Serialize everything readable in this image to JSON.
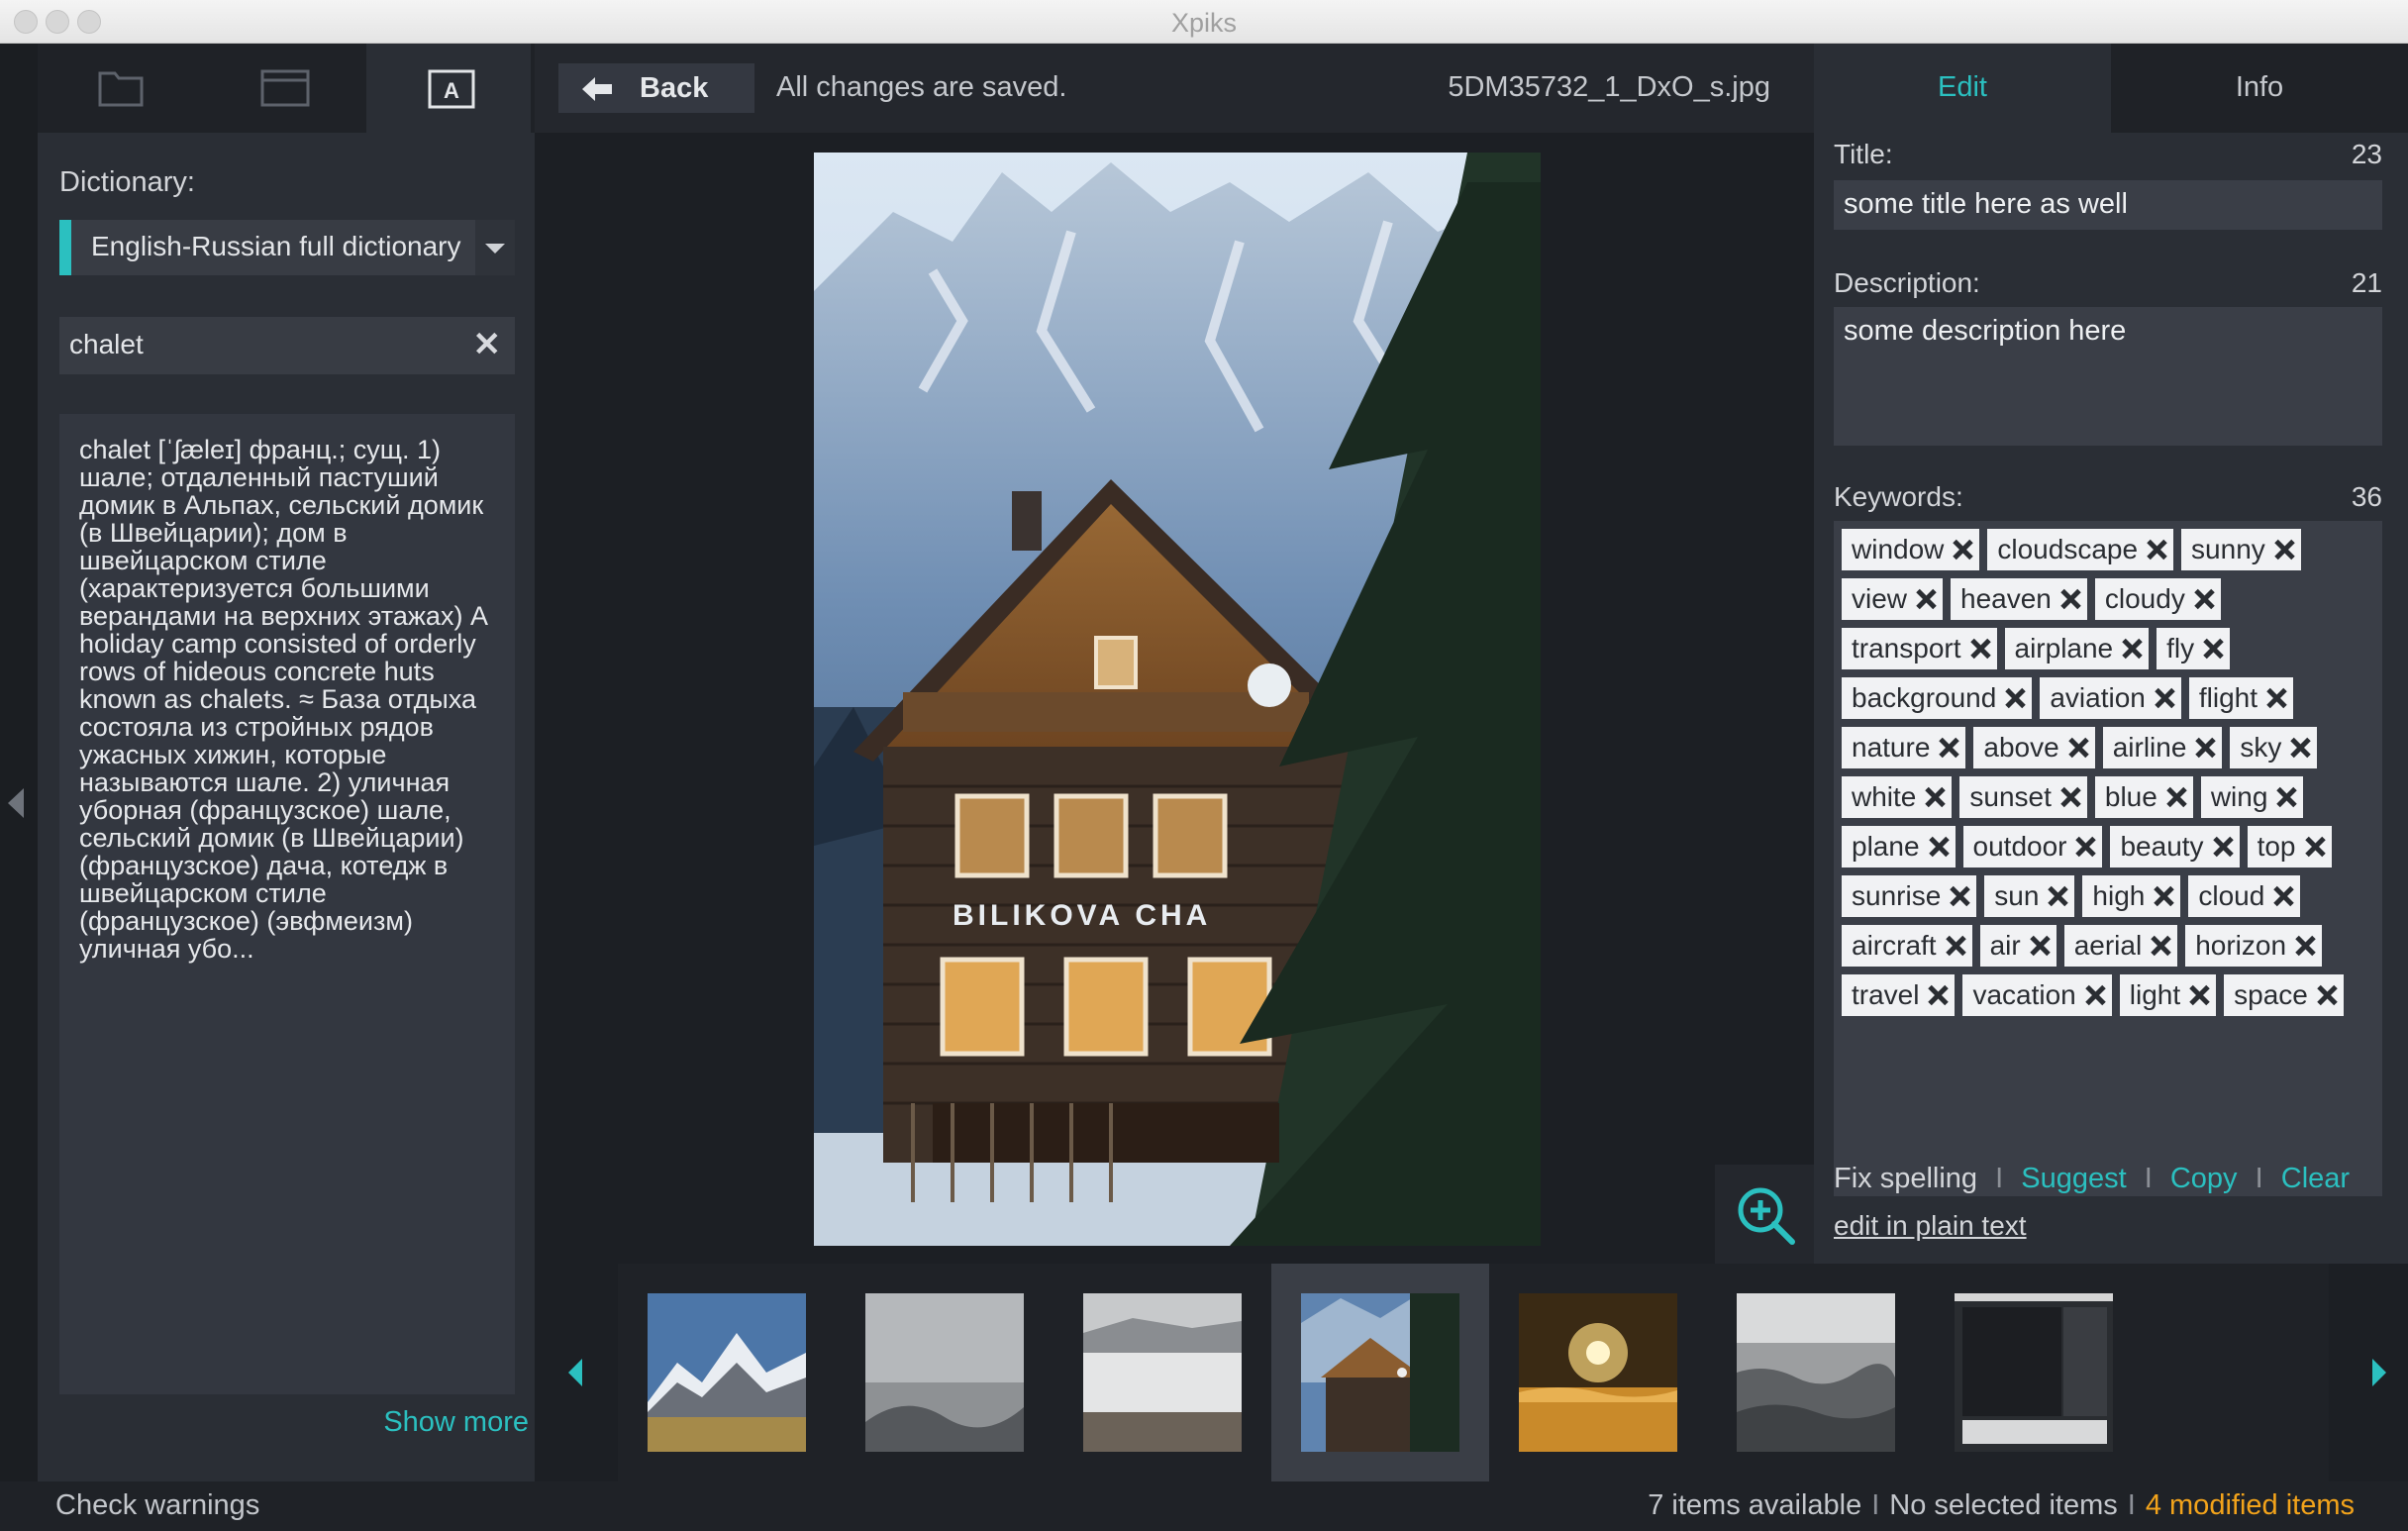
{
  "app": {
    "title": "Xpiks"
  },
  "left_panel": {
    "tabs": [
      {
        "icon": "folder-icon"
      },
      {
        "icon": "window-icon"
      },
      {
        "icon": "dictionary-icon",
        "letter": "A",
        "active": true
      }
    ],
    "dictionary_label": "Dictionary:",
    "dictionary_selected": "English-Russian full dictionary",
    "search_value": "chalet",
    "definition": "chalet [ˈʃæleɪ] франц.; сущ. 1) шале; отдаленный пастуший домик в Альпах, сельский домик (в Швейцарии); дом в швейцарском стиле (характеризуется большими верандами на верхних этажах) A holiday camp consisted of orderly rows of hideous concrete huts known as chalets. ≈ База отдыха состояла из стройных рядов ужасных хижин, которые называются шале. 2) уличная уборная (французское) шале, сельский домик (в Швейцарии) (французское) дача, котедж в швейцарском стиле (французское) (эвфмеизм) уличная убо...",
    "show_more": "Show more"
  },
  "center": {
    "back_label": "Back",
    "save_status": "All changes are saved.",
    "filename": "5DM35732_1_DxO_s.jpg",
    "photo_sign": "BILIKOVA CHA"
  },
  "filmstrip": {
    "thumbnails": [
      {
        "name": "mountains-thumb",
        "selected": false
      },
      {
        "name": "fog-forest-thumb",
        "selected": false
      },
      {
        "name": "misty-valley-thumb",
        "selected": false
      },
      {
        "name": "chalet-thumb",
        "selected": true
      },
      {
        "name": "sunset-clouds-thumb",
        "selected": false
      },
      {
        "name": "cloud-layer-thumb",
        "selected": false
      },
      {
        "name": "screenshot-thumb",
        "selected": false
      }
    ]
  },
  "right_panel": {
    "tabs": {
      "edit": "Edit",
      "info": "Info"
    },
    "title_label": "Title:",
    "title_count": "23",
    "title_value": "some title here as well",
    "description_label": "Description:",
    "description_count": "21",
    "description_value": "some description here",
    "keywords_label": "Keywords:",
    "keywords_count": "36",
    "keywords": [
      "window",
      "cloudscape",
      "sunny",
      "view",
      "heaven",
      "cloudy",
      "transport",
      "airplane",
      "fly",
      "background",
      "aviation",
      "flight",
      "nature",
      "above",
      "airline",
      "sky",
      "white",
      "sunset",
      "blue",
      "wing",
      "plane",
      "outdoor",
      "beauty",
      "top",
      "sunrise",
      "sun",
      "high",
      "cloud",
      "aircraft",
      "air",
      "aerial",
      "horizon",
      "travel",
      "vacation",
      "light",
      "space"
    ],
    "actions": {
      "fix_spelling": "Fix spelling",
      "suggest": "Suggest",
      "copy": "Copy",
      "clear": "Clear",
      "separator": "I"
    },
    "edit_plain": "edit in plain text"
  },
  "status": {
    "check_warnings": "Check warnings",
    "items_available": "7 items available",
    "selected": "No selected items",
    "modified": "4 modified items",
    "separator": "I"
  },
  "colors": {
    "accent": "#2bc0c0",
    "modified": "#f2a31b",
    "background": "#24272d"
  }
}
